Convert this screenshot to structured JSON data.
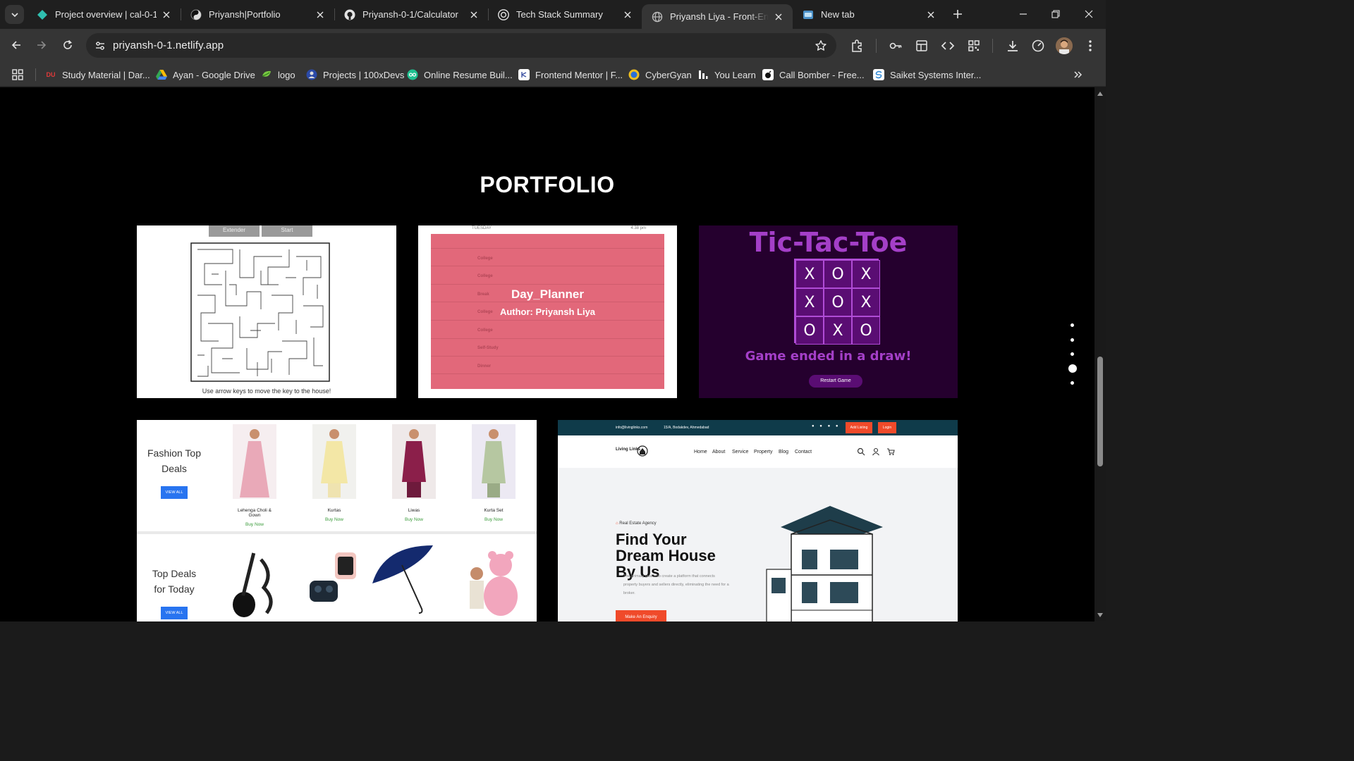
{
  "browser": {
    "tabs": [
      {
        "title": "Project overview | cal-0-1 |",
        "icon": "netlify-icon",
        "active": false
      },
      {
        "title": "Priyansh|Portfolio",
        "icon": "portfolio-icon",
        "active": false
      },
      {
        "title": "Priyansh-0-1/Calculator",
        "icon": "github-icon",
        "active": false
      },
      {
        "title": "Tech Stack Summary",
        "icon": "openai-icon",
        "active": false
      },
      {
        "title": "Priyansh Liya - Front-End &",
        "icon": "globe-icon",
        "active": true
      },
      {
        "title": "New tab",
        "icon": "new-tab-page-icon",
        "active": false
      }
    ],
    "url": "priyansh-0-1.netlify.app",
    "bookmarks": [
      {
        "label": "Study Material | Dar...",
        "icon": "du-icon",
        "color": "#e03a3a"
      },
      {
        "label": "Ayan - Google Drive",
        "icon": "google-drive-icon",
        "color": "#34a853"
      },
      {
        "label": "logo",
        "icon": "logo-icon",
        "color": "#7ac943"
      },
      {
        "label": "Projects | 100xDevs",
        "icon": "100xdevs-icon",
        "color": "#2b4aa8"
      },
      {
        "label": "Online Resume Buil...",
        "icon": "resume-builder-icon",
        "color": "#1fbf8f"
      },
      {
        "label": "Frontend Mentor | F...",
        "icon": "frontend-mentor-icon",
        "color": "#ffffff"
      },
      {
        "label": "CyberGyan",
        "icon": "cybergyan-icon",
        "color": "#f0c020"
      },
      {
        "label": "You Learn",
        "icon": "you-learn-icon",
        "color": "#ffffff"
      },
      {
        "label": "Call Bomber - Free...",
        "icon": "call-bomber-icon",
        "color": "#ffffff"
      },
      {
        "label": "Saiket Systems Inter...",
        "icon": "saiket-icon",
        "color": "#3a8fd8"
      }
    ]
  },
  "page": {
    "section_title": "PORTFOLIO",
    "maze": {
      "buttons": [
        "Extender",
        "Start"
      ],
      "caption": "Use arrow keys to move the key to the house!"
    },
    "planner": {
      "day": "TUESDAY",
      "time": "4:38 pm",
      "rows": [
        "College",
        "College",
        "Break",
        "College",
        "College",
        "Self-Study",
        "Dinner"
      ],
      "title": "Day_Planner",
      "author": "Author: Priyansh Liya"
    },
    "tictactoe": {
      "title": "Tic-Tac-Toe",
      "board": [
        "X",
        "O",
        "X",
        "X",
        "O",
        "X",
        "O",
        "X",
        "O"
      ],
      "result": "Game ended in a draw!",
      "restart": "Restart Game"
    },
    "fashion": {
      "deal_title_1": "Fashion Top Deals",
      "deal_title_2": "Top Deals for Today",
      "view_all": "VIEW ALL",
      "products": [
        {
          "name": "Lehenga Choli & Gown",
          "cta": "Buy Now",
          "color": "#e9a9b8"
        },
        {
          "name": "Kurtas",
          "cta": "Buy Now",
          "color": "#f3e7a6"
        },
        {
          "name": "Liwas",
          "cta": "Buy Now",
          "color": "#8b1f4a"
        },
        {
          "name": "Kurta Set",
          "cta": "Buy Now",
          "color": "#b6c7a1"
        }
      ]
    },
    "estate": {
      "email": "info@livinglinks.com",
      "address": "15/A, Bodakdev, Ahmedabad",
      "add_listing": "Add Listing",
      "login": "Login",
      "brand": "Living Links",
      "nav": [
        "Home",
        "About",
        "Service",
        "Property",
        "Blog",
        "Contact"
      ],
      "tag": "Real Estate Agency",
      "heading": "Find Your Dream House By Us",
      "description": "The primary goal is to create a platform that connects property buyers and sellers directly, eliminating the need for a broker.",
      "cta": "Make An Enquiry"
    }
  }
}
